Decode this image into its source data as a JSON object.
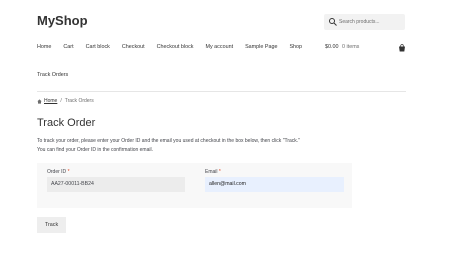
{
  "site": {
    "title": "MyShop"
  },
  "search": {
    "placeholder": "Search products..."
  },
  "nav": {
    "items": [
      "Home",
      "Cart",
      "Cart block",
      "Checkout",
      "Checkout block",
      "My account",
      "Sample Page",
      "Shop"
    ],
    "second_row": "Track Orders"
  },
  "cart": {
    "total": "$0.00",
    "count": "0 items"
  },
  "breadcrumb": {
    "home": "Home",
    "separator": "/",
    "current": "Track Orders"
  },
  "page": {
    "title": "Track Order",
    "intro_line1": "To track your order, please enter your Order ID and the email you used at checkout in the box below, then click \"Track.\"",
    "intro_line2": "You can find your Order ID in the confirmation email."
  },
  "form": {
    "order_label": "Order ID",
    "order_value": "AA27-00011-BB24",
    "email_label": "Email",
    "email_value": "allen@mail.com",
    "required_mark": "*",
    "submit_label": "Track"
  },
  "colors": {
    "required": "#e2401c",
    "autofill": "#e8f0fe"
  }
}
